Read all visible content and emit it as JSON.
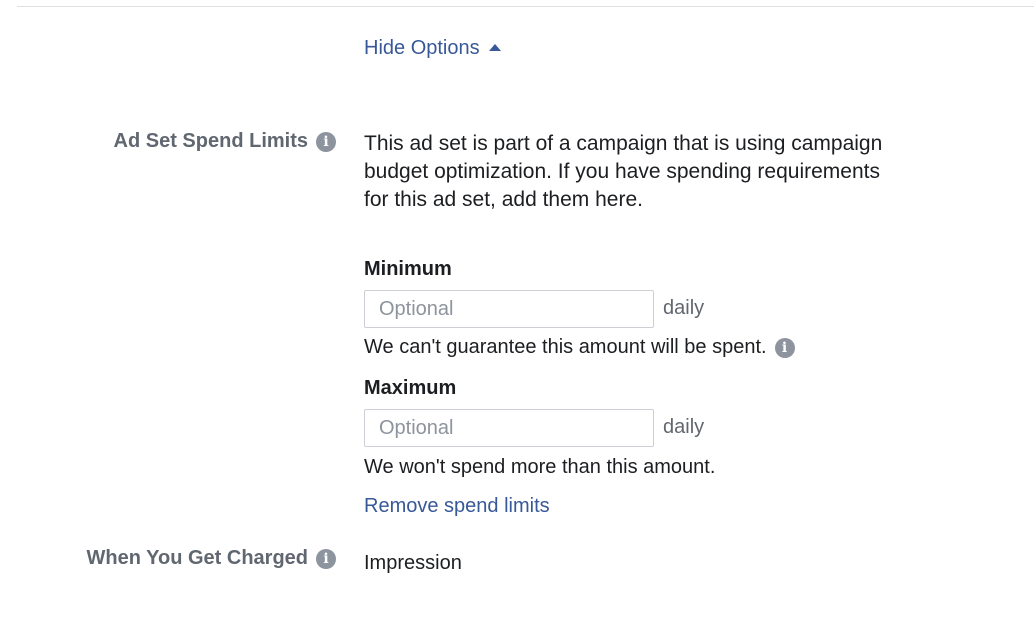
{
  "hide_options": {
    "label": "Hide Options",
    "icon": "caret-up-icon"
  },
  "spend_limits": {
    "label": "Ad Set Spend Limits",
    "info_icon": "info-icon",
    "description": "This ad set is part of a campaign that is using campaign budget optimization. If you have spending requirements for this ad set, add them here.",
    "minimum": {
      "title": "Minimum",
      "placeholder": "Optional",
      "value": "",
      "unit": "daily",
      "helper": "We can't guarantee this amount will be spent."
    },
    "maximum": {
      "title": "Maximum",
      "placeholder": "Optional",
      "value": "",
      "unit": "daily",
      "helper": "We won't spend more than this amount."
    },
    "remove_link": "Remove spend limits"
  },
  "charged": {
    "label": "When You Get Charged",
    "info_icon": "info-icon",
    "value": "Impression"
  },
  "colors": {
    "link": "#385898",
    "label": "#606770",
    "text": "#1c1e21",
    "placeholder": "#8d949e",
    "icon": "#8d949e",
    "border": "#ccd0d5"
  }
}
